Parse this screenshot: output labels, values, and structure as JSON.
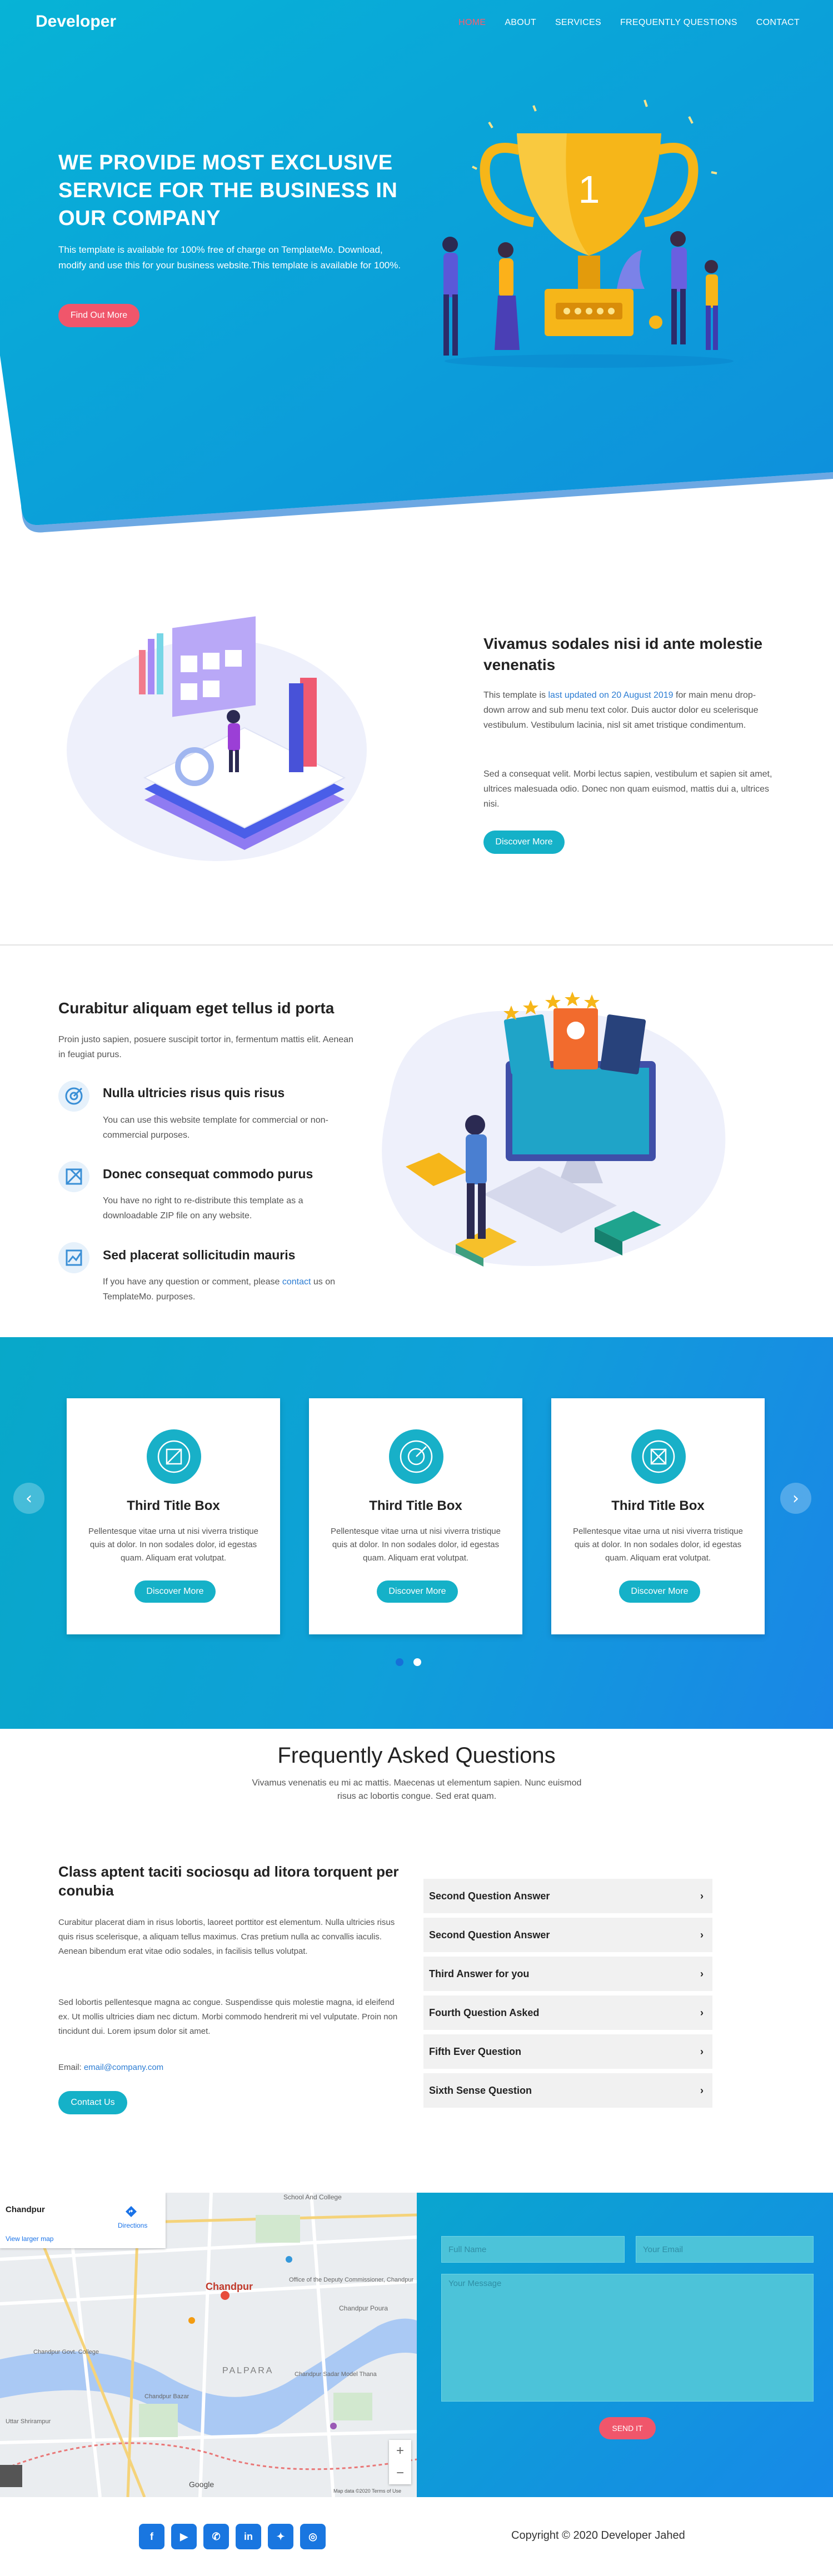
{
  "header": {
    "brand": "Developer",
    "nav": [
      {
        "label": "HOME",
        "active": true
      },
      {
        "label": "ABOUT"
      },
      {
        "label": "SERVICES"
      },
      {
        "label": "FREQUENTLY QUESTIONS"
      },
      {
        "label": "CONTACT"
      }
    ]
  },
  "hero": {
    "title": "WE PROVIDE MOST EXCLUSIVE SERVICE FOR THE BUSINESS IN OUR COMPANY",
    "text": "This template is available for 100% free of charge on TemplateMo. Download, modify and use this for your business website.This template is available for 100%.",
    "button": "Find Out More",
    "trophy_number": "1"
  },
  "about": {
    "title": "Vivamus sodales nisi id ante molestie venenatis",
    "p1_prefix": "This template is ",
    "p1_link": "last updated on 20 August 2019",
    "p1_suffix": " for main menu drop-down arrow and sub menu text color. Duis auctor dolor eu scelerisque vestibulum. Vestibulum lacinia, nisl sit amet tristique condimentum.",
    "p2": "Sed a consequat velit. Morbi lectus sapien, vestibulum et sapien sit amet, ultrices malesuada odio. Donec non quam euismod, mattis dui a, ultrices nisi.",
    "button": "Discover More"
  },
  "features": {
    "title": "Curabitur aliquam eget tellus id porta",
    "intro": "Proin justo sapien, posuere suscipit tortor in, fermentum mattis elit. Aenean in feugiat purus.",
    "items": [
      {
        "title": "Nulla ultricies risus quis risus",
        "text": "You can use this website template for commercial or non-commercial purposes.",
        "icon": "target-icon"
      },
      {
        "title": "Donec consequat commodo purus",
        "text": "You have no right to re-distribute this template as a downloadable ZIP file on any website.",
        "icon": "tools-icon"
      },
      {
        "title": "Sed placerat sollicitudin mauris",
        "text_prefix": "If you have any question or comment, please ",
        "link": "contact",
        "text_suffix": " us on TemplateMo. purposes.",
        "icon": "chart-icon"
      }
    ]
  },
  "services": {
    "cards": [
      {
        "title": "Third Title Box",
        "text": "Pellentesque vitae urna ut nisi viverra tristique quis at dolor. In non sodales dolor, id egestas quam. Aliquam erat volutpat.",
        "button": "Discover More"
      },
      {
        "title": "Third Title Box",
        "text": "Pellentesque vitae urna ut nisi viverra tristique quis at dolor. In non sodales dolor, id egestas quam. Aliquam erat volutpat.",
        "button": "Discover More"
      },
      {
        "title": "Third Title Box",
        "text": "Pellentesque vitae urna ut nisi viverra tristique quis at dolor. In non sodales dolor, id egestas quam. Aliquam erat volutpat.",
        "button": "Discover More"
      }
    ],
    "prev": "‹",
    "next": "›"
  },
  "faq": {
    "heading": "Frequently Asked Questions",
    "subheading": "Vivamus venenatis eu mi ac mattis. Maecenas ut elementum sapien. Nunc euismod risus ac lobortis congue. Sed erat quam.",
    "left_title": "Class aptent taciti sociosqu ad litora torquent per conubia",
    "p1": "Curabitur placerat diam in risus lobortis, laoreet porttitor est elementum. Nulla ultricies risus quis risus scelerisque, a aliquam tellus maximus. Cras pretium nulla ac convallis iaculis. Aenean bibendum erat vitae odio sodales, in facilisis tellus volutpat.",
    "p2": "Sed lobortis pellentesque magna ac congue. Suspendisse quis molestie magna, id eleifend ex. Ut mollis ultricies diam nec dictum. Morbi commodo hendrerit mi vel vulputate. Proin non tincidunt dui. Lorem ipsum dolor sit amet.",
    "email_label": "Email: ",
    "email": "email@company.com",
    "button": "Contact Us",
    "questions": [
      "Second Question Answer",
      "Second Question Answer",
      "Third Answer for you",
      "Fourth Question Asked",
      "Fifth Ever Question",
      "Sixth Sense Question"
    ]
  },
  "map": {
    "place": "Chandpur",
    "directions": "Directions",
    "larger": "View larger map",
    "city_label": "Chandpur",
    "labels": [
      "School And College",
      "Office of the Deputy Commissioner, Chandpur",
      "Chandpur Poura",
      "PALPARA",
      "Chandpur Govt. College",
      "Chandpur Sadar Model Thana",
      "Chandpur Bazar",
      "Uttar Shrirampur"
    ],
    "zoom_in": "+",
    "zoom_out": "−",
    "google": "Google",
    "attribution": "Map data ©2020 Terms of Use"
  },
  "contact": {
    "full_name": "Full Name",
    "email": "Your Email",
    "message": "Your Message",
    "button": "SEND IT"
  },
  "footer": {
    "social": [
      "facebook-icon",
      "youtube-icon",
      "whatsapp-icon",
      "linkedin-icon",
      "twitter-icon",
      "instagram-icon"
    ],
    "copyright": "Copyright © 2020 Developer Jahed"
  },
  "colors": {
    "accent_red": "#f0566b",
    "teal": "#15b1c8",
    "hero_blue": "#0aa7d6",
    "footer_icon": "#1976e0"
  }
}
